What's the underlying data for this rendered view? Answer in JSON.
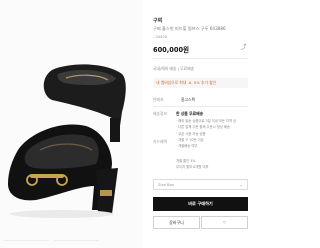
{
  "product": {
    "brand": "구찌",
    "name": "구찌 홀스빗 미드힐 펌프스 구두 643886",
    "code": "- 2A400",
    "price": "600,000원"
  },
  "delivery_note": "국내/해외 배송 | 무료배송",
  "member_banner": "내 멤버십으로 최대 -6, 5% 추가 할인",
  "seller": {
    "label": "판매처",
    "value": "홈고스팩"
  },
  "shipping": {
    "label": "배송정보",
    "title": "한 상품 무료배송",
    "lines": [
      "· 해외 발송 상품으로 3일 이내 모든 지역 상",
      "· 다른 업체 주문 함께 주문시 정상 배송",
      "· 쿠폰 사용 가능 상품",
      "· 개별 구 10만 이상",
      "· 개별배송 여부"
    ]
  },
  "card": {
    "label": "카드혜택",
    "lines": [
      "개별 할인 5%",
      "무이자 할부 6개월 여부"
    ]
  },
  "size_select": {
    "placeholder": "Size Box"
  },
  "buttons": {
    "buy": "바로 구매하기",
    "cart": "장바구니",
    "wish": "♡"
  },
  "icons": {
    "share": "share-icon",
    "chevron": "chevron-down-icon"
  }
}
